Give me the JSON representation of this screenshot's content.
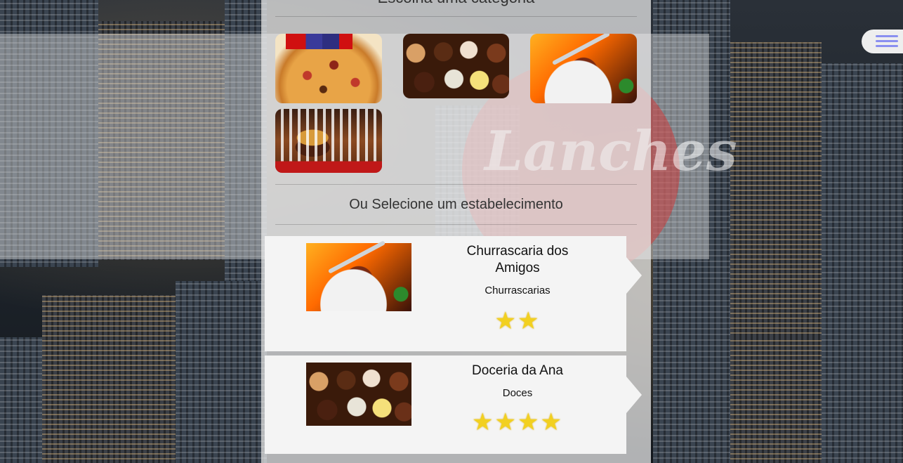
{
  "header": {
    "category_title": "Escolha uma categoria"
  },
  "categories": [
    {
      "name": "Pizzas",
      "icon": "pizza-image"
    },
    {
      "name": "Doces",
      "icon": "chocolates-image"
    },
    {
      "name": "Churrascarias",
      "icon": "grill-image"
    },
    {
      "name": "Lanches",
      "icon": "burger-image"
    }
  ],
  "logo_watermark": "Lanches",
  "select_title": "Ou Selecione um estabelecimento",
  "establishments": [
    {
      "name": "Churrascaria dos Amigos",
      "category": "Churrascarias",
      "stars": "★★",
      "rating": 2
    },
    {
      "name": "Doceria da Ana",
      "category": "Doces",
      "stars": "★★★★",
      "rating": 4
    }
  ],
  "colors": {
    "panel": "#eeeeee",
    "card": "#f4f4f4",
    "star": "#f2d020",
    "menu_icon": "#8a8ff0",
    "logo": "#cd3c3c"
  }
}
